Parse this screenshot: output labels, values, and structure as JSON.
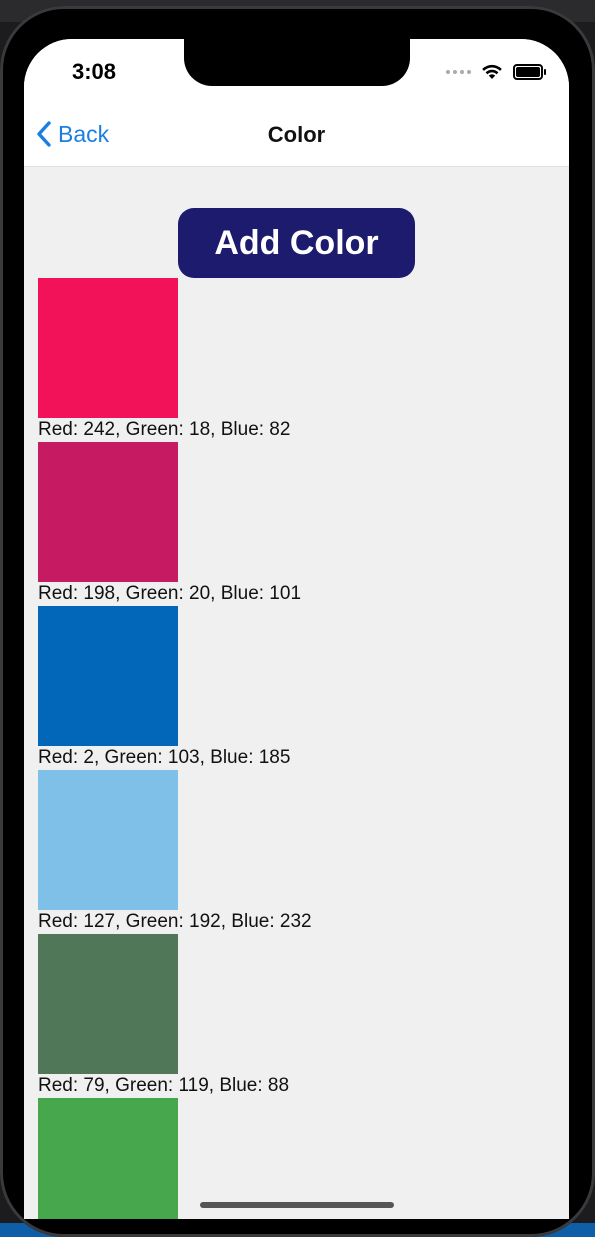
{
  "status_bar": {
    "time": "3:08"
  },
  "nav": {
    "back_label": "Back",
    "title": "Color"
  },
  "main": {
    "add_button_label": "Add Color"
  },
  "colors": [
    {
      "hex": "#f2125a",
      "label": "Red: 242, Green: 18, Blue: 82"
    },
    {
      "hex": "#c61b63",
      "label": "Red: 198, Green: 20, Blue: 101"
    },
    {
      "hex": "#0267b9",
      "label": "Red: 2, Green: 103, Blue: 185"
    },
    {
      "hex": "#7fc0e8",
      "label": "Red: 127, Green: 192, Blue: 232"
    },
    {
      "hex": "#4f7758",
      "label": "Red: 79, Green: 119, Blue: 88"
    },
    {
      "hex": "#47a74c",
      "label": ""
    }
  ],
  "theme": {
    "accent": "#1a7fe0",
    "button_bg": "#1c1b6e",
    "screen_bg": "#f0f0f0"
  }
}
